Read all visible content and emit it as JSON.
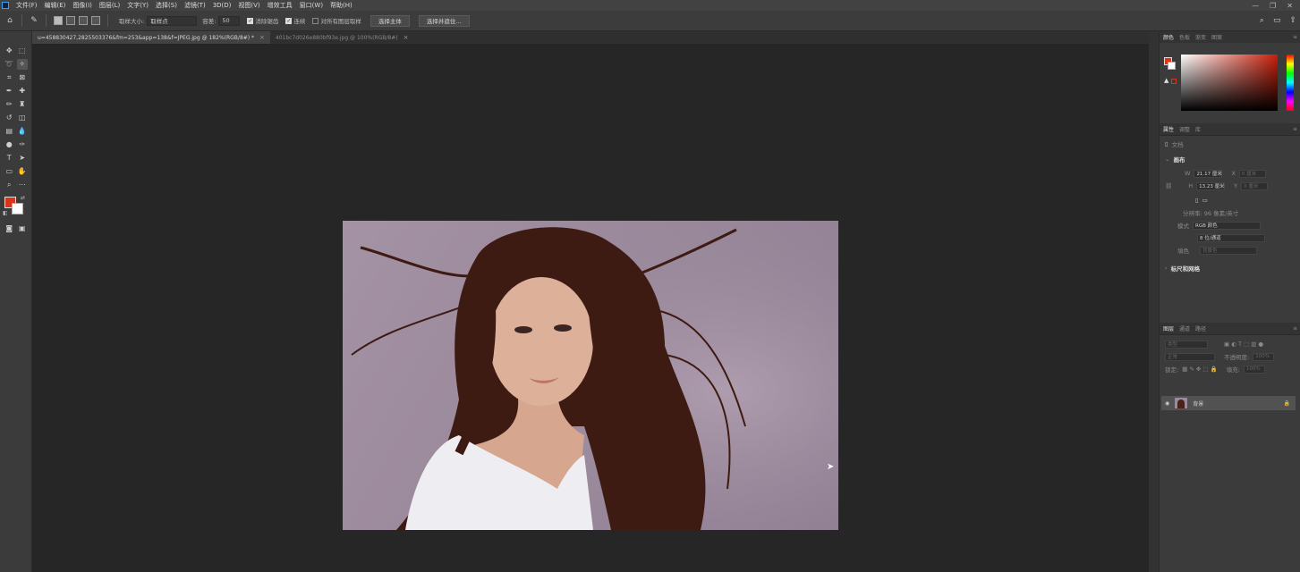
{
  "menubar": {
    "items": [
      "文件(F)",
      "编辑(E)",
      "图像(I)",
      "图层(L)",
      "文字(Y)",
      "选择(S)",
      "滤镜(T)",
      "3D(D)",
      "视图(V)",
      "增效工具",
      "窗口(W)",
      "帮助(H)"
    ],
    "win_controls": [
      "—",
      "❐",
      "✕"
    ]
  },
  "options": {
    "sample_size_label": "取样大小:",
    "sample_size_value": "取样点",
    "tolerance_label": "容差:",
    "tolerance_value": "50",
    "antialias_label": "消除锯齿",
    "contiguous_label": "连续",
    "sample_all_label": "对所有图层取样",
    "select_subject_label": "选择主体",
    "select_mask_label": "选择并遮住..."
  },
  "tabs": [
    {
      "label": "u=458830427,2825503376&fm=253&app=138&f=JPEG.jpg @ 182%(RGB/8#) *",
      "active": true
    },
    {
      "label": "401bc7d026e880bf93e.jpg @ 100%(RGB/8#)",
      "active": false
    }
  ],
  "colors": {
    "foreground": "#d8361a",
    "background": "#ffffff",
    "accent": "#2fa3f7"
  },
  "panels": {
    "color_tabs": [
      "颜色",
      "色板",
      "渐变",
      "图案"
    ],
    "props_tabs": [
      "属性",
      "调整",
      "库"
    ],
    "props": {
      "doc_label": "文档",
      "canvas_section": "画布",
      "w_label": "W",
      "w_value": "21.17 厘米",
      "x_label": "X",
      "x_value": "0 厘米",
      "h_label": "H",
      "h_value": "13.23 厘米",
      "y_label": "Y",
      "y_value": "0 厘米",
      "resolution": "分辨率: 96 像素/英寸",
      "mode_label": "模式",
      "mode_value": "RGB 颜色",
      "bit_depth": "8 位/通道",
      "fill_label": "填色",
      "fill_value": "背景色",
      "rulers_section": "标尺和网格"
    },
    "layers_tabs": [
      "图层",
      "通道",
      "路径"
    ],
    "layers": {
      "filter_placeholder": "类型",
      "blend_mode": "正常",
      "opacity_label": "不透明度:",
      "opacity_value": "100%",
      "lock_label": "锁定:",
      "fill_label": "填充:",
      "fill_value": "100%",
      "items": [
        {
          "name": "背景",
          "visible": true,
          "locked": true
        }
      ]
    }
  }
}
